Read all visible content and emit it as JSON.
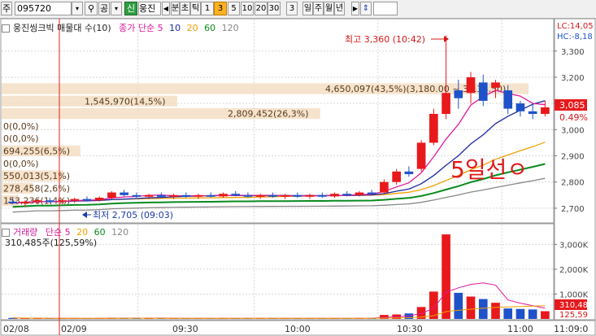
{
  "toolbar": {
    "market_label": "주",
    "code_value": "095720",
    "gong_label": "공",
    "sin_label": "신",
    "stock_name": "웅진",
    "period_tabs": [
      {
        "label": "분"
      },
      {
        "label": "초"
      },
      {
        "label": "틱"
      },
      {
        "label": "1"
      },
      {
        "label": "3",
        "selected": true
      },
      {
        "label": "5"
      },
      {
        "label": "10"
      },
      {
        "label": "20"
      },
      {
        "label": "30"
      },
      {
        "label": "3"
      },
      {
        "label": "일"
      },
      {
        "label": "주"
      },
      {
        "label": "월"
      },
      {
        "label": "년"
      }
    ]
  },
  "price_panel": {
    "legend_title": "웅진씽크빅 매물대 수(10)",
    "ma_label": "종가 단순",
    "ma_periods": [
      "5",
      "10",
      "20",
      "60",
      "120"
    ],
    "lc_label": "LC:14,05",
    "hc_label": "HC:-8,18",
    "current_price": "3,085",
    "change_pct": "0.49%",
    "high_annotation": "최고 3,360 (10:42)",
    "low_annotation": "최저 2,705 (09:03)",
    "handwritten_note": "5일선ㅇ",
    "volume_profile": [
      {
        "label": "4,650,097(43,5%)(3,180.00 ~ 3,134.50)",
        "pct": 43.5
      },
      {
        "label": "1,545,970(14,5%)",
        "pct": 14.5
      },
      {
        "label": "2,809,452(26,3%)",
        "pct": 26.3
      },
      {
        "label": "0(0,0%)",
        "pct": 0
      },
      {
        "label": "0(0,0%)",
        "pct": 0
      },
      {
        "label": "694,255(6,5%)",
        "pct": 6.5
      },
      {
        "label": "0(0,0%)",
        "pct": 0
      },
      {
        "label": "550,013(5,1%)",
        "pct": 5.1
      },
      {
        "label": "278,458(2,6%)",
        "pct": 2.6
      },
      {
        "label": "153,236(1,4%)",
        "pct": 1.4
      }
    ],
    "y_ticks": [
      "3,300",
      "3,200",
      "3,100",
      "3,000",
      "2,900",
      "2,800",
      "2,700"
    ]
  },
  "volume_panel": {
    "legend_title": "거래량",
    "ma_label": "단순",
    "ma_periods": [
      "5",
      "20",
      "60",
      "120"
    ],
    "current_value": "310,485주(125,59%)",
    "badge_value": "310,48",
    "badge_pct": "125,59",
    "y_ticks": [
      "3,000K",
      "2,000K",
      "1,000K"
    ]
  },
  "x_axis": {
    "labels": [
      "02/08",
      "02/09",
      "09:30",
      "10:00",
      "10:30",
      "11:00",
      "11:09:0"
    ]
  },
  "colors": {
    "up": "#e8191c",
    "down": "#1f52c9",
    "ma5": "#e0189a",
    "ma10": "#1a2aa0",
    "ma20": "#f0a000",
    "ma60": "#0a8a20",
    "ma120": "#888888",
    "profile_bar": "#f3dcc0"
  },
  "chart_data": {
    "type": "candlestick",
    "interval": "3분",
    "x": [
      "09:00",
      "09:03",
      "09:06",
      "09:09",
      "09:12",
      "09:15",
      "09:18",
      "09:21",
      "09:24",
      "09:27",
      "09:30",
      "09:33",
      "09:36",
      "09:39",
      "09:42",
      "09:45",
      "09:48",
      "09:51",
      "09:54",
      "09:57",
      "10:00",
      "10:03",
      "10:06",
      "10:09",
      "10:12",
      "10:15",
      "10:18",
      "10:21",
      "10:24",
      "10:27",
      "10:30",
      "10:33",
      "10:36",
      "10:39",
      "10:42",
      "10:45",
      "10:48",
      "10:51",
      "10:54",
      "10:57",
      "11:00",
      "11:03",
      "11:06",
      "11:09"
    ],
    "series": [
      {
        "name": "price",
        "ohlc": [
          [
            2725,
            2740,
            2715,
            2720
          ],
          [
            2720,
            2730,
            2705,
            2725
          ],
          [
            2725,
            2735,
            2715,
            2730
          ],
          [
            2730,
            2740,
            2720,
            2725
          ],
          [
            2725,
            2735,
            2715,
            2730
          ],
          [
            2730,
            2740,
            2720,
            2735
          ],
          [
            2735,
            2745,
            2725,
            2730
          ],
          [
            2730,
            2745,
            2725,
            2740
          ],
          [
            2740,
            2765,
            2735,
            2760
          ],
          [
            2760,
            2770,
            2745,
            2750
          ],
          [
            2750,
            2760,
            2740,
            2745
          ],
          [
            2745,
            2755,
            2735,
            2750
          ],
          [
            2750,
            2760,
            2740,
            2745
          ],
          [
            2745,
            2755,
            2735,
            2750
          ],
          [
            2750,
            2760,
            2740,
            2745
          ],
          [
            2745,
            2755,
            2735,
            2750
          ],
          [
            2750,
            2760,
            2740,
            2745
          ],
          [
            2745,
            2760,
            2740,
            2755
          ],
          [
            2755,
            2765,
            2745,
            2750
          ],
          [
            2750,
            2760,
            2740,
            2745
          ],
          [
            2745,
            2755,
            2735,
            2750
          ],
          [
            2750,
            2760,
            2740,
            2745
          ],
          [
            2745,
            2755,
            2735,
            2750
          ],
          [
            2750,
            2760,
            2740,
            2745
          ],
          [
            2745,
            2755,
            2735,
            2750
          ],
          [
            2750,
            2760,
            2740,
            2745
          ],
          [
            2745,
            2760,
            2740,
            2755
          ],
          [
            2755,
            2765,
            2745,
            2750
          ],
          [
            2750,
            2765,
            2745,
            2760
          ],
          [
            2760,
            2770,
            2750,
            2755
          ],
          [
            2760,
            2810,
            2755,
            2800
          ],
          [
            2800,
            2850,
            2790,
            2840
          ],
          [
            2840,
            2860,
            2820,
            2830
          ],
          [
            2850,
            2960,
            2840,
            2950
          ],
          [
            2950,
            3080,
            2940,
            3060
          ],
          [
            3060,
            3360,
            3040,
            3140
          ],
          [
            3150,
            3190,
            3080,
            3120
          ],
          [
            3140,
            3220,
            3100,
            3200
          ],
          [
            3180,
            3210,
            3090,
            3110
          ],
          [
            3160,
            3190,
            3120,
            3180
          ],
          [
            3150,
            3170,
            3060,
            3080
          ],
          [
            3100,
            3110,
            3050,
            3070
          ],
          [
            3070,
            3100,
            3040,
            3060
          ],
          [
            3060,
            3110,
            3050,
            3085
          ]
        ]
      },
      {
        "name": "volume_k",
        "values": [
          40,
          25,
          20,
          22,
          18,
          22,
          20,
          25,
          45,
          40,
          30,
          28,
          26,
          25,
          24,
          22,
          30,
          28,
          25,
          22,
          24,
          22,
          25,
          24,
          22,
          26,
          24,
          28,
          30,
          34,
          160,
          180,
          220,
          480,
          1100,
          3400,
          1050,
          900,
          800,
          650,
          420,
          400,
          380,
          310
        ]
      }
    ],
    "ylim_price": [
      2650,
      3380
    ],
    "ylim_volume": [
      0,
      3600
    ],
    "grid": true
  }
}
